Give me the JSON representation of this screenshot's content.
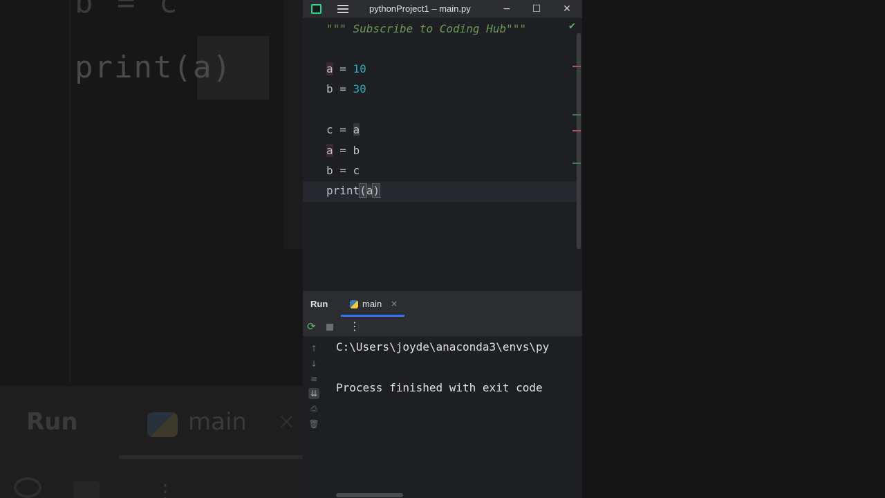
{
  "window": {
    "title": "pythonProject1 – main.py",
    "minimize_glyph": "−",
    "maximize_glyph": "☐",
    "close_glyph": "✕"
  },
  "editor": {
    "docstring": "\"\"\" Subscribe to Coding Hub\"\"\"",
    "lines": [
      {
        "var": "a",
        "op": " = ",
        "value": "10"
      },
      {
        "var": "b",
        "op": " = ",
        "value": "30"
      },
      {
        "var": "c",
        "op": " = ",
        "value": "a"
      },
      {
        "var": "a",
        "op": " = ",
        "value": "b"
      },
      {
        "var": "b",
        "op": " = ",
        "value": "c"
      }
    ],
    "print_fn": "print",
    "print_open": "(",
    "print_arg": "a",
    "print_close": ")",
    "inspection_icon": "check-icon"
  },
  "run_panel": {
    "label": "Run",
    "tab_label": "main",
    "tab_close": "×",
    "console_lines": [
      "C:\\Users\\joyde\\anaconda3\\envs\\py",
      "Process finished with exit code"
    ]
  },
  "background": {
    "code_top": "b = c",
    "code_print": "print(a)",
    "run_label": "Run",
    "tab_label": "main",
    "tab_close": "×"
  },
  "colors": {
    "accent": "#3574f0",
    "number": "#2aacb8",
    "comment": "#6a9955",
    "success": "#5fb865",
    "app_logo": "#21d789"
  }
}
